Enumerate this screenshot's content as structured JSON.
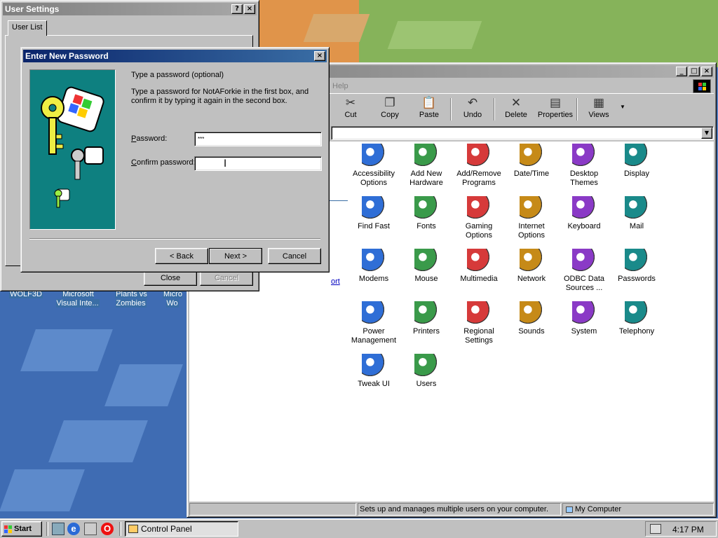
{
  "desktop": {
    "icons": [
      {
        "label": "WOLF3D"
      },
      {
        "label": "Microsoft Visual Inte..."
      },
      {
        "label": "Plants vs Zombies"
      },
      {
        "label": "Micro Wo"
      }
    ]
  },
  "control_panel": {
    "menu_help": "Help",
    "toolbar": [
      {
        "label": "Cut",
        "icon": "scissors-icon"
      },
      {
        "label": "Copy",
        "icon": "copy-icon"
      },
      {
        "label": "Paste",
        "icon": "paste-icon"
      },
      {
        "label": "Undo",
        "icon": "undo-icon"
      },
      {
        "label": "Delete",
        "icon": "delete-x-icon"
      },
      {
        "label": "Properties",
        "icon": "properties-icon"
      },
      {
        "label": "Views",
        "icon": "views-icon"
      }
    ],
    "side_link": "ort",
    "items": [
      {
        "label": "Accessibility Options"
      },
      {
        "label": "Add New Hardware"
      },
      {
        "label": "Add/Remove Programs"
      },
      {
        "label": "Date/Time"
      },
      {
        "label": "Desktop Themes"
      },
      {
        "label": "Display"
      },
      {
        "label": "Find Fast"
      },
      {
        "label": "Fonts"
      },
      {
        "label": "Gaming Options"
      },
      {
        "label": "Internet Options"
      },
      {
        "label": "Keyboard"
      },
      {
        "label": "Mail"
      },
      {
        "label": "Modems"
      },
      {
        "label": "Mouse"
      },
      {
        "label": "Multimedia"
      },
      {
        "label": "Network"
      },
      {
        "label": "ODBC Data Sources ..."
      },
      {
        "label": "Passwords"
      },
      {
        "label": "Power Management"
      },
      {
        "label": "Printers"
      },
      {
        "label": "Regional Settings"
      },
      {
        "label": "Sounds"
      },
      {
        "label": "System"
      },
      {
        "label": "Telephony"
      },
      {
        "label": "Tweak UI"
      },
      {
        "label": "Users"
      }
    ],
    "status_text": "Sets up and manages multiple users on your computer.",
    "status_location": "My Computer"
  },
  "user_settings": {
    "title": "User Settings",
    "tab": "User List",
    "close_label": "Close",
    "cancel_label": "Cancel"
  },
  "password_dialog": {
    "title": "Enter New Password",
    "heading": "Type a password (optional)",
    "instructions": "Type a password for NotAForkie in the first box, and confirm it by typing it again in the second box.",
    "password_label": "Password:",
    "password_value": "***",
    "confirm_label": "Confirm password:",
    "confirm_value": "",
    "back_label": "< Back",
    "next_label": "Next >",
    "cancel_label": "Cancel"
  },
  "taskbar": {
    "start_label": "Start",
    "task_label": "Control Panel",
    "clock": "4:17 PM"
  },
  "colors": {
    "titlebar_active": "#0a246a",
    "face": "#c0c0c0",
    "dialog_art_bg": "#0e8080"
  }
}
